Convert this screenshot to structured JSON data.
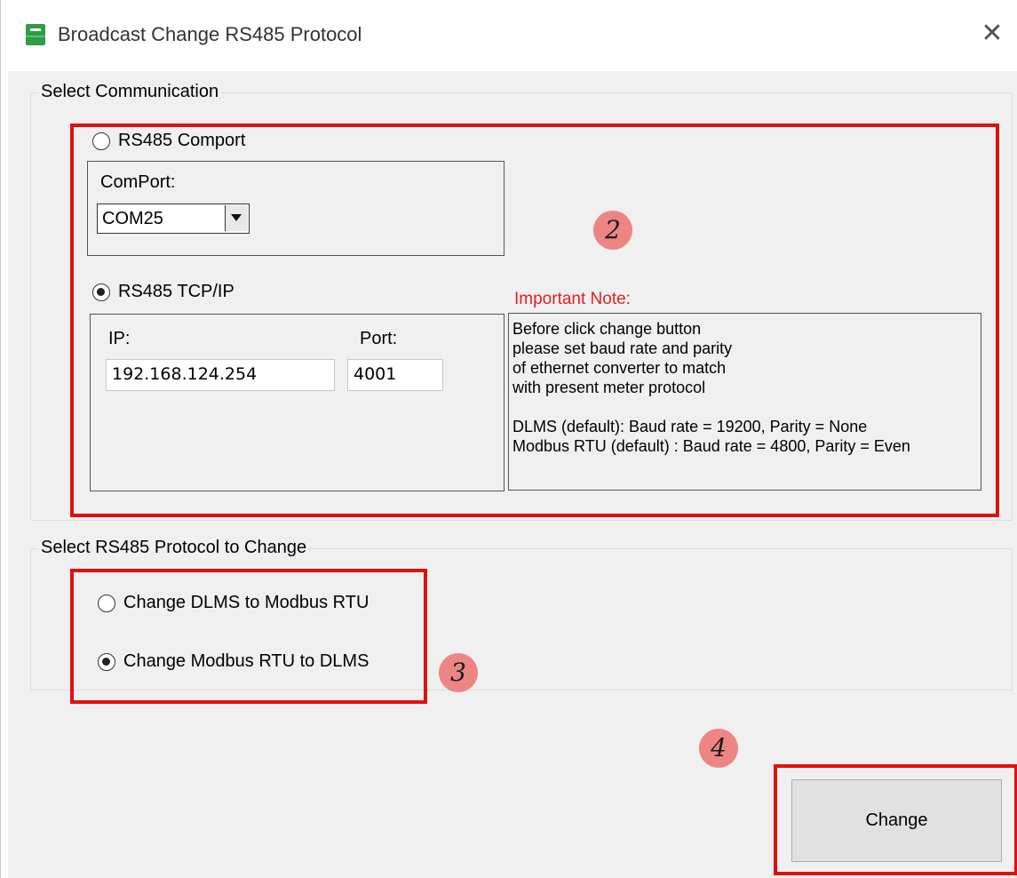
{
  "window": {
    "title": "Broadcast Change RS485 Protocol",
    "app_icon": "app-icon",
    "close_icon": "close-icon",
    "close_glyph": "✕"
  },
  "communication": {
    "legend": "Select Communication",
    "comport_option": {
      "label": "RS485 Comport",
      "selected": false
    },
    "comport_label": "ComPort:",
    "comport_value": "COM25",
    "tcp_option": {
      "label": "RS485 TCP/IP",
      "selected": true
    },
    "ip_label": "IP:",
    "ip_value": "192.168.124.254",
    "port_label": "Port:",
    "port_value": "4001",
    "note_title": "Important Note:",
    "note_lines": [
      "Before click change button",
      "please set baud rate and parity",
      "of ethernet converter to match",
      "with present meter protocol",
      "DLMS (default): Baud rate = 19200, Parity = None",
      "Modbus RTU (default) : Baud rate = 4800, Parity = Even"
    ]
  },
  "protocol": {
    "legend": "Select RS485 Protocol to Change",
    "options": [
      {
        "label": "Change DLMS to Modbus RTU",
        "selected": false
      },
      {
        "label": "Change Modbus RTU to DLMS",
        "selected": true
      }
    ]
  },
  "actions": {
    "change_label": "Change"
  },
  "annotations": {
    "marker2": "2",
    "marker3": "3",
    "marker4": "4"
  },
  "colors": {
    "highlight": "#e01010",
    "marker": "#ee8585",
    "note_title": "#e02020"
  }
}
